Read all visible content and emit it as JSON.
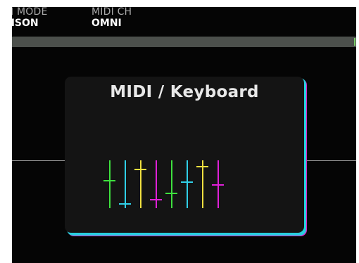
{
  "header": {
    "params": [
      {
        "label": "DI MODE",
        "value": "NISON"
      },
      {
        "label": "MIDI CH",
        "value": "OMNI"
      }
    ]
  },
  "dialog": {
    "title": "MIDI / Keyboard",
    "icon": "mixer-faders-icon",
    "fader_levels": [
      0.42,
      0.93,
      0.18,
      0.83,
      0.7,
      0.45,
      0.12,
      0.52
    ],
    "fader_colors": [
      "#3ee03e",
      "#30d0e8",
      "#f0e040",
      "#e020d8",
      "#3ee03e",
      "#30d0e8",
      "#f0e040",
      "#e020d8"
    ]
  },
  "colors": {
    "screen_bg": "#050505",
    "header_bar": "#4c504c",
    "card_bg": "#141414",
    "shadow_cyan": "#28d0e0",
    "shadow_magenta": "#e020c8"
  }
}
